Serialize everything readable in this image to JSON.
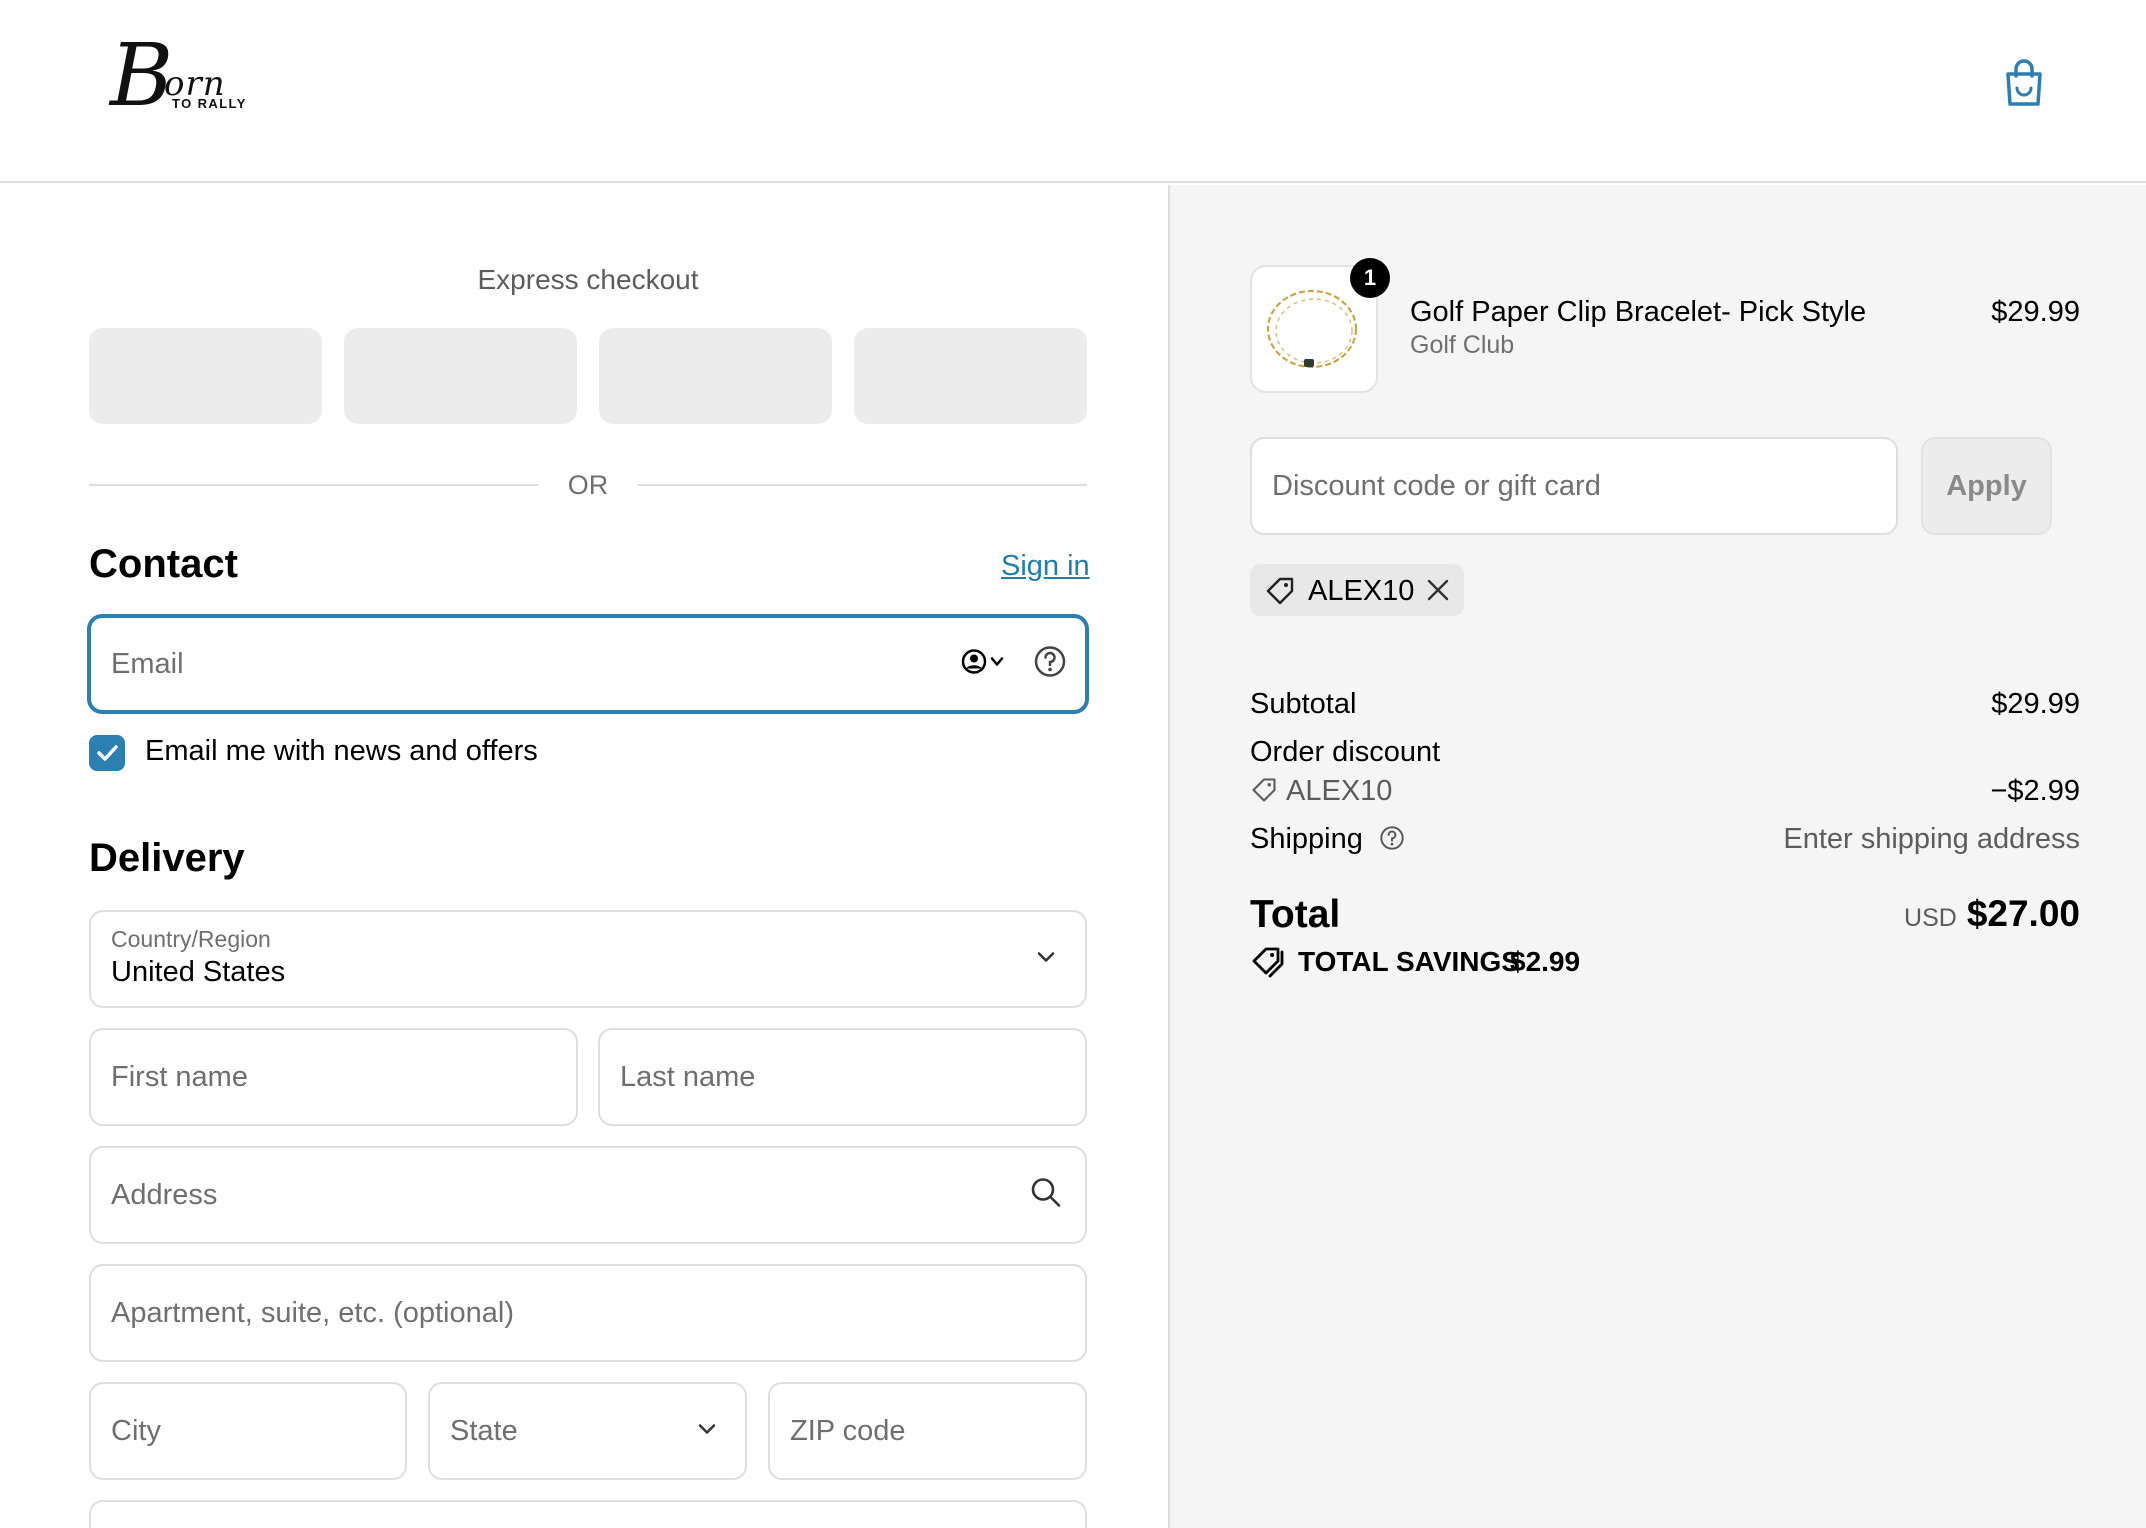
{
  "header": {
    "logo_script": "B",
    "logo_word": "orn",
    "logo_sub": "TO RALLY",
    "cart_icon": "shopping-bag-icon"
  },
  "express": {
    "title": "Express checkout",
    "or_label": "OR"
  },
  "contact": {
    "title": "Contact",
    "sign_in": "Sign in",
    "email_placeholder": "Email",
    "news_label": "Email me with news and offers",
    "news_checked": true
  },
  "delivery": {
    "title": "Delivery",
    "country_label": "Country/Region",
    "country_value": "United States",
    "first_name_placeholder": "First name",
    "last_name_placeholder": "Last name",
    "address_placeholder": "Address",
    "apartment_placeholder": "Apartment, suite, etc. (optional)",
    "city_placeholder": "City",
    "state_placeholder": "State",
    "zip_placeholder": "ZIP code"
  },
  "summary": {
    "product": {
      "name": "Golf Paper Clip Bracelet- Pick Style",
      "variant": "Golf Club",
      "price": "$29.99",
      "quantity": "1"
    },
    "discount_placeholder": "Discount code or gift card",
    "apply_label": "Apply",
    "applied_code": "ALEX10",
    "subtotal_label": "Subtotal",
    "subtotal_value": "$29.99",
    "order_discount_label": "Order discount",
    "order_discount_code": "ALEX10",
    "order_discount_value": "−$2.99",
    "shipping_label": "Shipping",
    "shipping_value": "Enter shipping address",
    "total_label": "Total",
    "total_currency": "USD",
    "total_value": "$27.00",
    "savings_label": "TOTAL SAVINGS",
    "savings_value": "$2.99"
  },
  "colors": {
    "accent": "#2b7fb1",
    "link": "#1f7fa8",
    "summary_bg": "#f5f5f5"
  }
}
